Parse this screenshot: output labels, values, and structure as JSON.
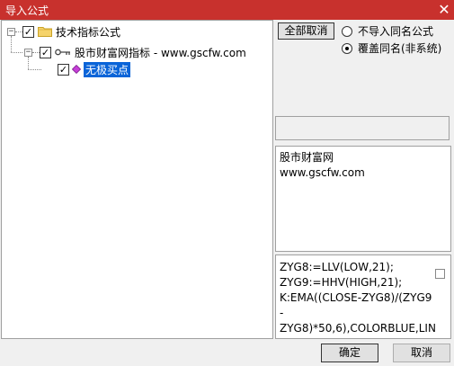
{
  "window": {
    "title": "导入公式",
    "close_glyph": "✕"
  },
  "tree": {
    "root": {
      "label": "技术指标公式",
      "checked": true,
      "expander": "−"
    },
    "group": {
      "label": "股市财富网指标 - www.gscfw.com",
      "checked": true,
      "expander": "−"
    },
    "item": {
      "label": "无极买点",
      "checked": true,
      "selected": true
    }
  },
  "options": {
    "deselect_all_label": "全部取消",
    "radio_skip_label": "不导入同名公式",
    "radio_overwrite_label": "覆盖同名(非系统)",
    "selected_radio": "overwrite"
  },
  "description": "股市财富网\nwww.gscfw.com",
  "formula_code": "ZYG8:=LLV(LOW,21);\nZYG9:=HHV(HIGH,21);\nK:EMA((CLOSE-ZYG8)/(ZYG9\n-\nZYG8)*50,6),COLORBLUE,LIN",
  "footer": {
    "ok_label": "确定",
    "cancel_label": "取消"
  },
  "colors": {
    "titlebar": "#c8312d",
    "selection": "#0a64d8"
  }
}
